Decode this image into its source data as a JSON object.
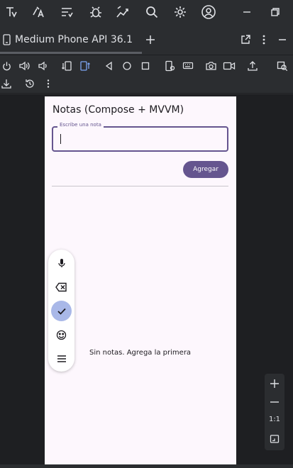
{
  "ide": {
    "device_tab": {
      "label": "Medium Phone API 36.1"
    }
  },
  "app": {
    "title": "Notas (Compose + MVVM)",
    "note_field": {
      "label": "Escribe una nota",
      "value": ""
    },
    "add_button_label": "Agregar",
    "empty_message": "Sin notas. Agrega la primera"
  },
  "zoom": {
    "ratio_label": "1:1"
  },
  "colors": {
    "primary": "#65558f",
    "surface": "#fdf7fd",
    "ide_background": "#2b2d30",
    "ide_text": "#dfe1e5",
    "keyboard_check": "#a9b8e8"
  },
  "icons": {
    "top_toolbar": [
      "project-icon",
      "translate-icon",
      "list-filter-icon",
      "bug-icon",
      "profiler-icon",
      "search-icon",
      "settings-icon",
      "account-icon",
      "minimize-icon",
      "restore-icon"
    ],
    "tab_actions": [
      "android-device-icon",
      "add-tab-icon",
      "open-external-icon",
      "more-vertical-icon",
      "minimize-panel-icon"
    ],
    "emulator_toolbar": [
      "power-icon",
      "volume-up-icon",
      "volume-down-icon",
      "rotate-left-icon",
      "rotate-right-icon",
      "back-icon",
      "home-icon",
      "overview-icon",
      "device-settings-icon",
      "keyboard-icon",
      "screenshot-icon",
      "record-icon",
      "share-icon",
      "zoom-area-icon",
      "download-icon",
      "history-icon",
      "more-vertical-icon"
    ],
    "keyboard_toolbar": [
      "microphone-icon",
      "backspace-icon",
      "check-icon",
      "emoji-icon",
      "menu-icon"
    ],
    "zoom_panel": [
      "zoom-in-icon",
      "zoom-out-icon",
      "fit-screen-icon"
    ]
  }
}
